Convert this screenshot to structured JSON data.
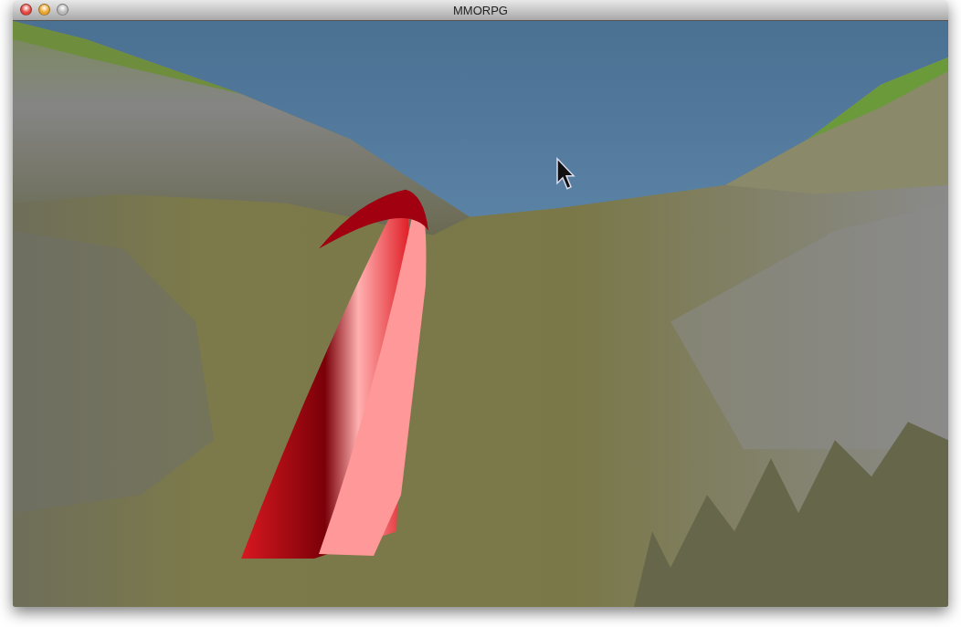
{
  "window": {
    "title": "MMORPG"
  },
  "window_buttons": [
    {
      "kind": "close",
      "disabled": false
    },
    {
      "kind": "minimize",
      "disabled": false
    },
    {
      "kind": "zoom",
      "disabled": true
    }
  ]
}
